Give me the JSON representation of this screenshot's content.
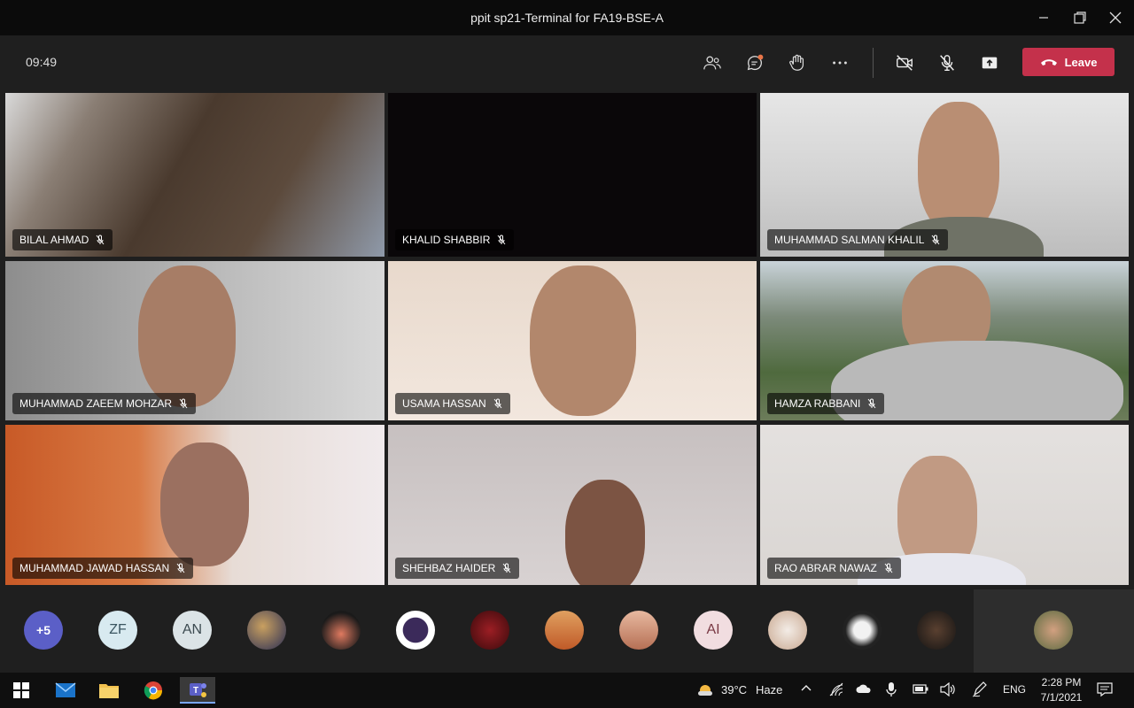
{
  "window": {
    "title": "ppit sp21-Terminal for FA19-BSE-A"
  },
  "meeting": {
    "timer": "09:49",
    "leave_label": "Leave"
  },
  "participants": [
    {
      "name": "BILAL AHMAD",
      "muted": true
    },
    {
      "name": "KHALID SHABBIR",
      "muted": true
    },
    {
      "name": "MUHAMMAD SALMAN KHALIL",
      "muted": true
    },
    {
      "name": "MUHAMMAD ZAEEM MOHZAR",
      "muted": true
    },
    {
      "name": "USAMA HASSAN",
      "muted": true
    },
    {
      "name": "HAMZA RABBANI",
      "muted": true
    },
    {
      "name": "MUHAMMAD JAWAD HASSAN",
      "muted": true
    },
    {
      "name": "SHEHBAZ HAIDER",
      "muted": true
    },
    {
      "name": "RAO ABRAR NAWAZ",
      "muted": true
    }
  ],
  "strip": {
    "overflow": "+5",
    "initials": [
      "ZF",
      "AN",
      "AI"
    ]
  },
  "taskbar": {
    "weather_temp": "39°C",
    "weather_text": "Haze",
    "language": "ENG",
    "time": "2:28 PM",
    "date": "7/1/2021"
  },
  "colors": {
    "leave": "#c4314b",
    "overflow_avatar": "#5b5fc7",
    "notification_dot": "#e97548"
  }
}
